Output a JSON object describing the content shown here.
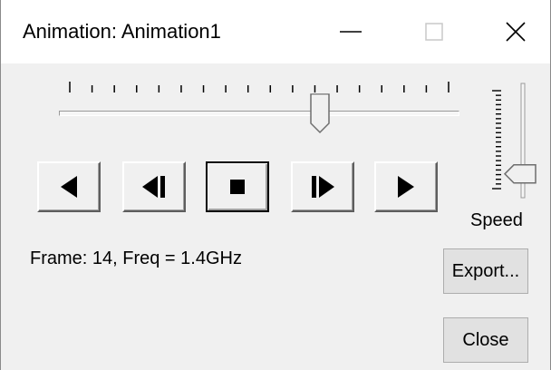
{
  "window": {
    "title": "Animation: Animation1"
  },
  "titlebar_buttons": {
    "minimize": "minimize-icon",
    "maximize": "maximize-icon",
    "close": "close-icon"
  },
  "frame_slider": {
    "tick_count": 18,
    "position_fraction": 0.66
  },
  "transport": [
    {
      "name": "play-reverse",
      "icon": "play-reverse-icon"
    },
    {
      "name": "step-back",
      "icon": "step-back-icon"
    },
    {
      "name": "stop",
      "icon": "stop-icon",
      "pressed": true
    },
    {
      "name": "step-forward",
      "icon": "step-forward-icon"
    },
    {
      "name": "play",
      "icon": "play-icon"
    }
  ],
  "speed": {
    "label": "Speed",
    "tick_count": 22,
    "position_fraction": 0.85
  },
  "status": {
    "text": "Frame: 14, Freq = 1.4GHz"
  },
  "buttons": {
    "export": "Export...",
    "close": "Close"
  },
  "colors": {
    "window_bg": "#f0f0f0",
    "titlebar_bg": "#ffffff",
    "button_bg": "#e1e1e1",
    "button_border": "#adadad"
  }
}
